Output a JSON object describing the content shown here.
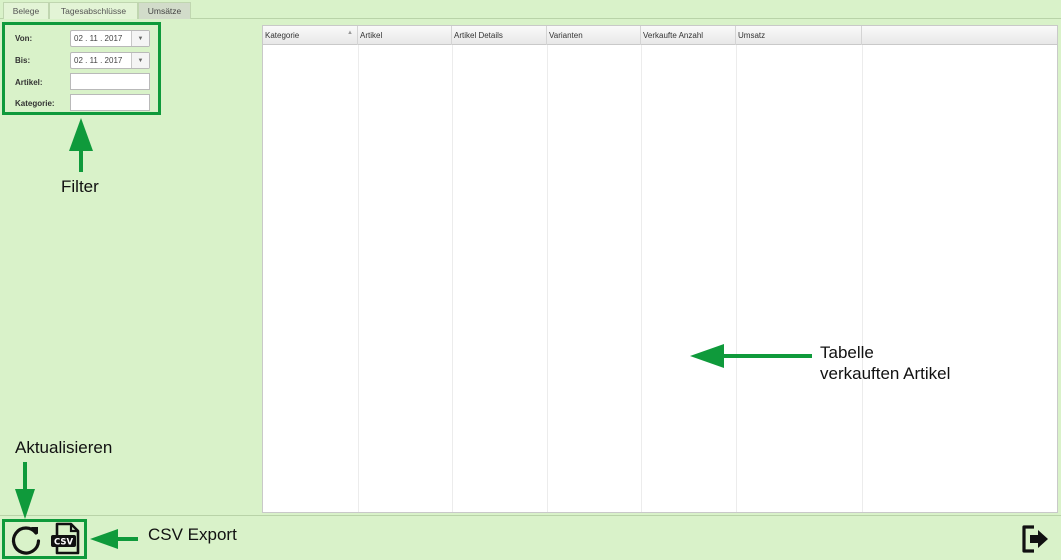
{
  "tabs": [
    {
      "label": "Belege",
      "active": false
    },
    {
      "label": "Tagesabschlüsse",
      "active": false
    },
    {
      "label": "Umsätze",
      "active": true
    }
  ],
  "filter": {
    "from_label": "Von:",
    "from_value": "02 . 11 . 2017",
    "to_label": "Bis:",
    "to_value": "02 . 11 . 2017",
    "article_label": "Artikel:",
    "article_value": "",
    "category_label": "Kategorie:",
    "category_value": ""
  },
  "table": {
    "columns": [
      "Kategorie",
      "Artikel",
      "Artikel Details",
      "Varianten",
      "Verkaufte Anzahl",
      "Umsatz"
    ],
    "sorted_column": "Kategorie",
    "rows": []
  },
  "annotations": {
    "filter": "Filter",
    "table_line1": "Tabelle",
    "table_line2": "verkauften Artikel",
    "refresh": "Aktualisieren",
    "csv": "CSV Export"
  },
  "icons": {
    "refresh": "refresh-icon",
    "csv": "csv-file-icon",
    "logout": "logout-icon",
    "dropdown": "chevron-down-icon"
  },
  "colors": {
    "background": "#d9f2c9",
    "annotation_green": "#0f9a3b"
  }
}
